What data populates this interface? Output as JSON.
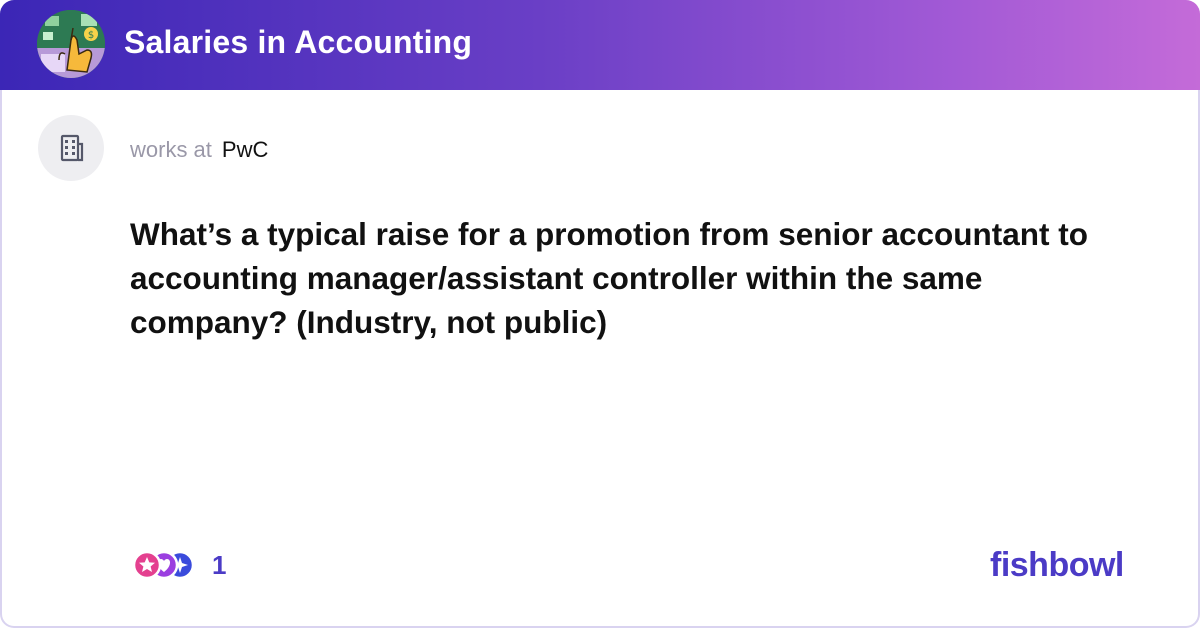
{
  "header": {
    "title": "Salaries in Accounting",
    "avatar_icon": "bowl-avatar-icon",
    "gradient": [
      "#3b26b6",
      "#6a3fc6",
      "#a35ad6",
      "#c46bd8"
    ]
  },
  "post": {
    "company_icon": "building-icon",
    "works_prefix": "works at",
    "company": "PwC",
    "question": "What’s a typical raise for a promotion from senior accountant to accounting manager/assistant controller within the same company? (Industry, not public)"
  },
  "footer": {
    "reaction_icons": [
      "star-reaction-icon",
      "heart-reaction-icon",
      "sparkle-reaction-icon"
    ],
    "reaction_count": "1",
    "brand": "fishbowl",
    "brand_color": "#4b3bc6"
  }
}
